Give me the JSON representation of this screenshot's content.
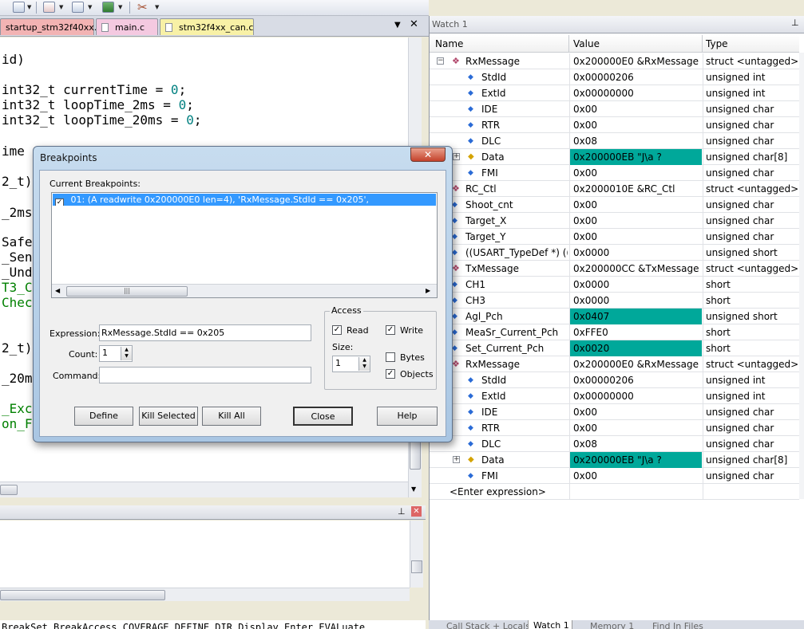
{
  "editor": {
    "tabs": [
      {
        "label": "startup_stm32f40xx.s",
        "color": "#f2b3b3"
      },
      {
        "label": "main.c",
        "color": "#f4c9e0"
      },
      {
        "label": "stm32f4xx_can.c",
        "color": "#f8f1a6"
      }
    ],
    "dropdown_icon": "chevron-down-icon",
    "close_icon": "close-icon",
    "code_lines": [
      {
        "segments": [
          {
            "text": "id)",
            "color": "#000000"
          }
        ]
      },
      {
        "segments": [
          {
            "text": "int32_t currentTime = ",
            "color": "#000000"
          },
          {
            "text": "0",
            "color": "#008080"
          },
          {
            "text": ";",
            "color": "#000000"
          }
        ]
      },
      {
        "segments": [
          {
            "text": "int32_t loopTime_2ms = ",
            "color": "#000000"
          },
          {
            "text": "0",
            "color": "#008080"
          },
          {
            "text": ";",
            "color": "#000000"
          }
        ]
      },
      {
        "segments": [
          {
            "text": "int32_t loopTime_20ms = ",
            "color": "#000000"
          },
          {
            "text": "0",
            "color": "#008080"
          },
          {
            "text": ";",
            "color": "#000000"
          }
        ]
      },
      {
        "segments": [
          {
            "text": "ime",
            "color": "#000000"
          }
        ]
      },
      {
        "segments": [
          {
            "text": "2_t)",
            "color": "#000000"
          }
        ]
      },
      {
        "segments": [
          {
            "text": "_2ms",
            "color": "#000000"
          }
        ]
      },
      {
        "segments": [
          {
            "text": "Safe",
            "color": "#000000"
          }
        ]
      },
      {
        "segments": [
          {
            "text": "_Sen",
            "color": "#000000"
          }
        ]
      },
      {
        "segments": [
          {
            "text": "_Und",
            "color": "#000000"
          }
        ]
      },
      {
        "segments": [
          {
            "text": "T3_C",
            "color": "#008000"
          }
        ]
      },
      {
        "segments": [
          {
            "text": "Chec",
            "color": "#008000"
          }
        ]
      },
      {
        "segments": [
          {
            "text": "2_t)",
            "color": "#000000"
          }
        ]
      },
      {
        "segments": [
          {
            "text": "_20m",
            "color": "#000000"
          }
        ]
      },
      {
        "segments": [
          {
            "text": "_Exc",
            "color": "#008000"
          }
        ]
      },
      {
        "segments": [
          {
            "text": "on_F",
            "color": "#008000"
          }
        ]
      }
    ]
  },
  "output_panel": {
    "pin_icon": "pin-icon",
    "close_icon": "close-icon"
  },
  "command_line": {
    "text": "BreakSet BreakAccess COVERAGE DEFINE DIR Display Enter EVALuate"
  },
  "watch": {
    "title": "Watch 1",
    "pin_icon": "pin-icon",
    "columns": {
      "name": "Name",
      "value": "Value",
      "type": "Type"
    },
    "highlight_color": "#00a89a",
    "rows": [
      {
        "name": "RxMessage",
        "value": "0x200000E0 &RxMessage",
        "type": "struct <untagged>",
        "depth": 0,
        "expander": "−",
        "icon": "struct-icon",
        "highlight": false
      },
      {
        "name": "StdId",
        "value": "0x00000206",
        "type": "unsigned int",
        "depth": 1,
        "expander": "",
        "icon": "field-icon",
        "highlight": false
      },
      {
        "name": "ExtId",
        "value": "0x00000000",
        "type": "unsigned int",
        "depth": 1,
        "expander": "",
        "icon": "field-icon",
        "highlight": false
      },
      {
        "name": "IDE",
        "value": "0x00",
        "type": "unsigned char",
        "depth": 1,
        "expander": "",
        "icon": "field-icon",
        "highlight": false
      },
      {
        "name": "RTR",
        "value": "0x00",
        "type": "unsigned char",
        "depth": 1,
        "expander": "",
        "icon": "field-icon",
        "highlight": false
      },
      {
        "name": "DLC",
        "value": "0x08",
        "type": "unsigned char",
        "depth": 1,
        "expander": "",
        "icon": "field-icon",
        "highlight": false
      },
      {
        "name": "Data",
        "value": "0x200000EB \"J\\a  ?",
        "type": "unsigned char[8]",
        "depth": 1,
        "expander": "+",
        "icon": "array-icon",
        "highlight": true
      },
      {
        "name": "FMI",
        "value": "0x00",
        "type": "unsigned char",
        "depth": 1,
        "expander": "",
        "icon": "field-icon",
        "highlight": false
      },
      {
        "name": "RC_Ctl",
        "value": "0x2000010E &RC_Ctl",
        "type": "struct <untagged>",
        "depth": 0,
        "expander": "+",
        "icon": "struct-icon",
        "highlight": false
      },
      {
        "name": "Shoot_cnt",
        "value": "0x00",
        "type": "unsigned char",
        "depth": 0,
        "expander": "",
        "icon": "field-icon",
        "highlight": false
      },
      {
        "name": "Target_X",
        "value": "0x00",
        "type": "unsigned char",
        "depth": 0,
        "expander": "",
        "icon": "field-icon",
        "highlight": false
      },
      {
        "name": "Target_Y",
        "value": "0x00",
        "type": "unsigned char",
        "depth": 0,
        "expander": "",
        "icon": "field-icon",
        "highlight": false
      },
      {
        "name": "((USART_TypeDef *) ((...",
        "value": "0x0000",
        "type": "unsigned short",
        "depth": 0,
        "expander": "+",
        "icon": "field-icon",
        "highlight": false
      },
      {
        "name": "TxMessage",
        "value": "0x200000CC &TxMessage",
        "type": "struct <untagged>",
        "depth": 0,
        "expander": "+",
        "icon": "struct-icon",
        "highlight": false
      },
      {
        "name": "CH1",
        "value": "0x0000",
        "type": "short",
        "depth": 0,
        "expander": "",
        "icon": "field-icon",
        "highlight": false
      },
      {
        "name": "CH3",
        "value": "0x0000",
        "type": "short",
        "depth": 0,
        "expander": "",
        "icon": "field-icon",
        "highlight": false
      },
      {
        "name": "Agl_Pch",
        "value": "0x0407",
        "type": "unsigned short",
        "depth": 0,
        "expander": "",
        "icon": "field-icon",
        "highlight": true
      },
      {
        "name": "MeaSr_Current_Pch",
        "value": "0xFFE0",
        "type": "short",
        "depth": 0,
        "expander": "",
        "icon": "field-icon",
        "highlight": false
      },
      {
        "name": "Set_Current_Pch",
        "value": "0x0020",
        "type": "short",
        "depth": 0,
        "expander": "",
        "icon": "field-icon",
        "highlight": true
      },
      {
        "name": "RxMessage",
        "value": "0x200000E0 &RxMessage",
        "type": "struct <untagged>",
        "depth": 0,
        "expander": "−",
        "icon": "struct-icon",
        "highlight": false
      },
      {
        "name": "StdId",
        "value": "0x00000206",
        "type": "unsigned int",
        "depth": 1,
        "expander": "",
        "icon": "field-icon",
        "highlight": false
      },
      {
        "name": "ExtId",
        "value": "0x00000000",
        "type": "unsigned int",
        "depth": 1,
        "expander": "",
        "icon": "field-icon",
        "highlight": false
      },
      {
        "name": "IDE",
        "value": "0x00",
        "type": "unsigned char",
        "depth": 1,
        "expander": "",
        "icon": "field-icon",
        "highlight": false
      },
      {
        "name": "RTR",
        "value": "0x00",
        "type": "unsigned char",
        "depth": 1,
        "expander": "",
        "icon": "field-icon",
        "highlight": false
      },
      {
        "name": "DLC",
        "value": "0x08",
        "type": "unsigned char",
        "depth": 1,
        "expander": "",
        "icon": "field-icon",
        "highlight": false
      },
      {
        "name": "Data",
        "value": "0x200000EB \"J\\a  ?",
        "type": "unsigned char[8]",
        "depth": 1,
        "expander": "+",
        "icon": "array-icon",
        "highlight": true
      },
      {
        "name": "FMI",
        "value": "0x00",
        "type": "unsigned char",
        "depth": 1,
        "expander": "",
        "icon": "field-icon",
        "highlight": false
      }
    ],
    "enter_expression": "<Enter expression>",
    "bottom_tabs": [
      "Call Stack + Locals",
      "Watch 1",
      "Memory 1",
      "Find In Files"
    ]
  },
  "dialog": {
    "title": "Breakpoints",
    "close_label": "✕",
    "current_label": "Current Breakpoints:",
    "breakpoint_item": "01: (A readwrite 0x200000E0 len=4),  'RxMessage.StdId == 0x205',",
    "expression_label": "Expression:",
    "expression_value": "RxMessage.StdId == 0x205",
    "count_label": "Count:",
    "count_value": "1",
    "command_label": "Command:",
    "command_value": "",
    "access_label": "Access",
    "read_label": "Read",
    "write_label": "Write",
    "size_label": "Size:",
    "size_value": "1",
    "bytes_label": "Bytes",
    "objects_label": "Objects",
    "read_checked": true,
    "write_checked": true,
    "bytes_checked": false,
    "objects_checked": true,
    "buttons": {
      "define": "Define",
      "kill_selected": "Kill Selected",
      "kill_all": "Kill All",
      "close": "Close",
      "help": "Help"
    }
  }
}
